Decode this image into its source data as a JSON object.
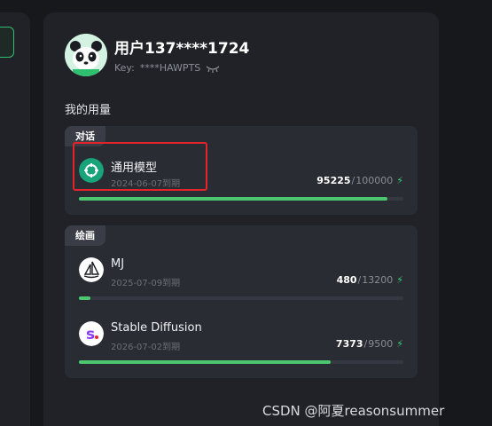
{
  "user": {
    "name": "用户137****1724",
    "key_label": "Key:",
    "key_value": "****HAWPTS"
  },
  "usage_title": "我的用量",
  "groups": [
    {
      "label": "对话",
      "models": [
        {
          "name": "通用模型",
          "expire": "2024-06-07到期",
          "used": "95225",
          "total": "100000",
          "fraction": 0.952,
          "icon": "openai-logo-icon"
        }
      ]
    },
    {
      "label": "绘画",
      "models": [
        {
          "name": "MJ",
          "expire": "2025-07-09到期",
          "used": "480",
          "total": "13200",
          "fraction": 0.036,
          "icon": "midjourney-logo-icon"
        },
        {
          "name": "Stable Diffusion",
          "expire": "2026-07-02到期",
          "used": "7373",
          "total": "9500",
          "fraction": 0.776,
          "icon": "stability-logo-icon"
        }
      ]
    }
  ],
  "watermark": "CSDN @阿夏reasonsummer",
  "colors": {
    "accent": "#4cc770",
    "highlight": "#e5232b"
  }
}
